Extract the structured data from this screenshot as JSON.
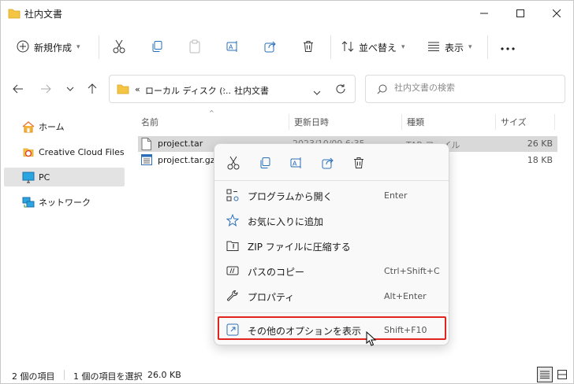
{
  "window": {
    "title": "社内文書"
  },
  "toolbar": {
    "new_label": "新規作成",
    "sort_label": "並べ替え",
    "view_label": "表示"
  },
  "address": {
    "path_prefix": "«",
    "segment1": "ローカル ディスク (...",
    "segment2": "社内文書",
    "search_placeholder": "社内文書の検索"
  },
  "sidebar": {
    "items": [
      {
        "label": "ホーム",
        "icon": "home-icon"
      },
      {
        "label": "Creative Cloud Files",
        "icon": "creative-cloud-icon"
      },
      {
        "label": "PC",
        "icon": "pc-icon",
        "selected": true
      },
      {
        "label": "ネットワーク",
        "icon": "network-icon"
      }
    ]
  },
  "filelist": {
    "columns": [
      "名前",
      "更新日時",
      "種類",
      "サイズ"
    ],
    "rows": [
      {
        "name": "project.tar",
        "date": "2023/10/09 6:35",
        "type": "TAR ファイル",
        "size": "26 KB",
        "selected": true
      },
      {
        "name": "project.tar.gz",
        "date": "",
        "type": "",
        "size": "18 KB",
        "selected": false
      }
    ]
  },
  "context_menu": {
    "items": [
      {
        "label": "プログラムから開く",
        "shortcut": "Enter",
        "icon": "open-with-icon"
      },
      {
        "label": "お気に入りに追加",
        "shortcut": "",
        "icon": "star-icon"
      },
      {
        "label": "ZIP ファイルに圧縮する",
        "shortcut": "",
        "icon": "zip-icon"
      },
      {
        "label": "パスのコピー",
        "shortcut": "Ctrl+Shift+C",
        "icon": "copy-path-icon"
      },
      {
        "label": "プロパティ",
        "shortcut": "Alt+Enter",
        "icon": "wrench-icon"
      },
      {
        "label": "その他のオプションを表示",
        "shortcut": "Shift+F10",
        "icon": "more-options-icon",
        "highlighted": true
      }
    ]
  },
  "statusbar": {
    "item_count": "2 個の項目",
    "selection": "1 個の項目を選択",
    "selection_size": "26.0 KB"
  },
  "colors": {
    "folder": "#f4c542",
    "accent": "#0067c0",
    "highlight_border": "#e0241e"
  }
}
